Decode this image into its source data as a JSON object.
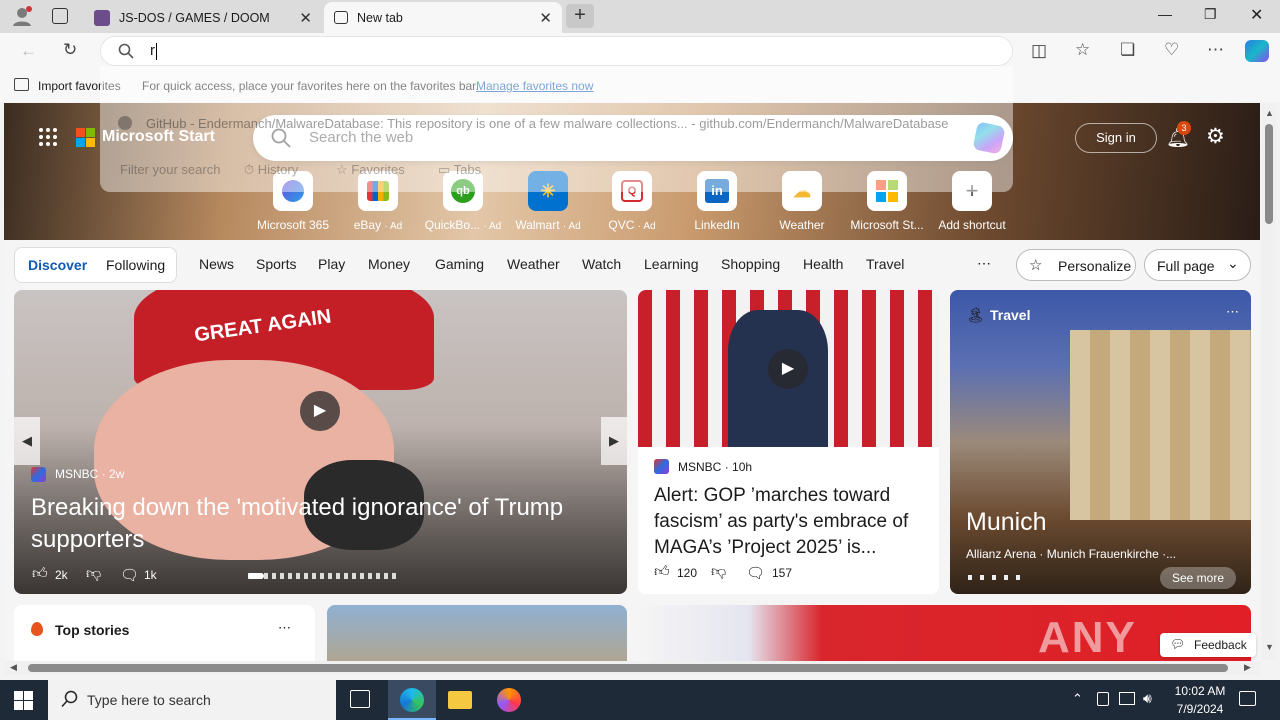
{
  "tabs": [
    {
      "label": "JS-DOS / GAMES / DOOM"
    },
    {
      "label": "New tab"
    }
  ],
  "address": {
    "value": "r"
  },
  "favorites_bar": {
    "import_label": "Import favorites",
    "hint": "For quick access, place your favorites here on the favorites bar.",
    "manage_link": "Manage favorites now"
  },
  "dropdown": {
    "suggestion": "GitHub - Endermanch/MalwareDatabase: This repository is one of a few malware collections...",
    "suggestion_url": "- github.com/Endermanch/MalwareDatabase",
    "filter_placeholder": "Filter your search",
    "filters": [
      "History",
      "Favorites",
      "Tabs"
    ]
  },
  "ms_start": {
    "brand": "Microsoft Start",
    "search_placeholder": "Search the web",
    "sign_in": "Sign in",
    "notification_count": "3"
  },
  "shortcuts": [
    {
      "label": "Microsoft 365",
      "ad": ""
    },
    {
      "label": "eBay",
      "ad": "· Ad"
    },
    {
      "label": "QuickBo...",
      "ad": "· Ad"
    },
    {
      "label": "Walmart",
      "ad": "· Ad"
    },
    {
      "label": "QVC",
      "ad": "· Ad"
    },
    {
      "label": "LinkedIn",
      "ad": ""
    },
    {
      "label": "Weather",
      "ad": ""
    },
    {
      "label": "Microsoft St...",
      "ad": ""
    },
    {
      "label": "Add shortcut",
      "ad": ""
    }
  ],
  "feed_tabs": {
    "discover": "Discover",
    "following": "Following"
  },
  "categories": [
    "News",
    "Sports",
    "Play",
    "Money",
    "Gaming",
    "Weather",
    "Watch",
    "Learning",
    "Shopping",
    "Health",
    "Travel"
  ],
  "personalize": "Personalize",
  "layout_select": "Full page",
  "cards": {
    "main": {
      "source": "MSNBC",
      "age": "· 2w",
      "headline": "Breaking down the 'motivated ignorance' of Trump supporters",
      "likes": "2k",
      "comments": "1k",
      "hat_text": "GREAT AGAIN"
    },
    "second": {
      "source": "MSNBC",
      "age": "· 10h",
      "headline": "Alert: GOP ’marches toward fascism’ as party's embrace of MAGA’s ’Project 2025’ is...",
      "likes": "120",
      "comments": "157"
    },
    "travel": {
      "label": "Travel",
      "title": "Munich",
      "subtitle": "Allianz Arena · Munich Frauenkirche ·...",
      "see_more": "See more"
    },
    "top_stories": {
      "title": "Top stories"
    }
  },
  "feedback": "Feedback",
  "watermark": "ANY RUN",
  "taskbar": {
    "search_placeholder": "Type here to search",
    "time": "10:02 AM",
    "date": "7/9/2024"
  }
}
